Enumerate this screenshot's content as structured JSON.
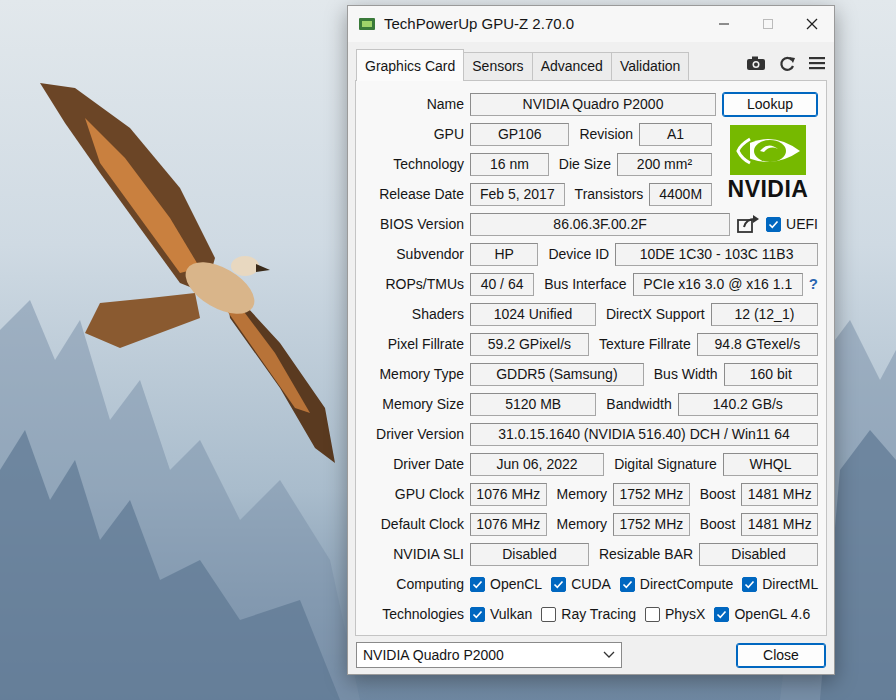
{
  "window": {
    "title": "TechPowerUp GPU-Z 2.70.0"
  },
  "tabs": [
    {
      "label": "Graphics Card",
      "selected": true
    },
    {
      "label": "Sensors",
      "selected": false
    },
    {
      "label": "Advanced",
      "selected": false
    },
    {
      "label": "Validation",
      "selected": false
    }
  ],
  "name_row": {
    "label": "Name",
    "value": "NVIDIA Quadro P2000",
    "button": "Lookup"
  },
  "logo": {
    "text": "NVIDIA"
  },
  "spec_rows": [
    {
      "label": "GPU",
      "cells": [
        {
          "value": "GP106"
        },
        {
          "label": "Revision",
          "value": "A1"
        }
      ]
    },
    {
      "label": "Technology",
      "cells": [
        {
          "value": "16 nm"
        },
        {
          "label": "Die Size",
          "value": "200 mm²"
        }
      ]
    },
    {
      "label": "Release Date",
      "cells": [
        {
          "value": "Feb 5, 2017"
        },
        {
          "label": "Transistors",
          "value": "4400M"
        }
      ]
    }
  ],
  "bios": {
    "label": "BIOS Version",
    "value": "86.06.3F.00.2F",
    "uefi": {
      "label": "UEFI",
      "checked": true
    }
  },
  "rows": [
    {
      "kind": "fields",
      "label": "Subvendor",
      "cells": [
        {
          "value": "HP"
        },
        {
          "label": "Device ID",
          "value": "10DE 1C30 - 103C 11B3"
        }
      ]
    },
    {
      "kind": "fields",
      "label": "ROPs/TMUs",
      "cells": [
        {
          "value": "40 / 64"
        },
        {
          "label": "Bus Interface",
          "value": "PCIe x16 3.0 @ x16 1.1"
        }
      ],
      "help": "?"
    },
    {
      "kind": "fields",
      "label": "Shaders",
      "cells": [
        {
          "value": "1024 Unified"
        },
        {
          "label": "DirectX Support",
          "value": "12 (12_1)"
        }
      ]
    },
    {
      "kind": "fields",
      "label": "Pixel Fillrate",
      "cells": [
        {
          "value": "59.2 GPixel/s"
        },
        {
          "label": "Texture Fillrate",
          "value": "94.8 GTexel/s"
        }
      ]
    },
    {
      "kind": "fields",
      "label": "Memory Type",
      "cells": [
        {
          "value": "GDDR5 (Samsung)"
        },
        {
          "label": "Bus Width",
          "value": "160 bit"
        }
      ]
    },
    {
      "kind": "fields",
      "label": "Memory Size",
      "cells": [
        {
          "value": "5120 MB"
        },
        {
          "label": "Bandwidth",
          "value": "140.2 GB/s"
        }
      ]
    },
    {
      "kind": "fields",
      "label": "Driver Version",
      "cells": [
        {
          "value": "31.0.15.1640 (NVIDIA 516.40) DCH / Win11 64"
        }
      ]
    },
    {
      "kind": "fields",
      "label": "Driver Date",
      "cells": [
        {
          "value": "Jun 06, 2022"
        },
        {
          "label": "Digital Signature",
          "value": "WHQL"
        }
      ]
    },
    {
      "kind": "fields",
      "label": "GPU Clock",
      "cells": [
        {
          "value": "1076 MHz"
        },
        {
          "label": "Memory",
          "value": "1752 MHz"
        },
        {
          "label": "Boost",
          "value": "1481 MHz"
        }
      ]
    },
    {
      "kind": "fields",
      "label": "Default Clock",
      "cells": [
        {
          "value": "1076 MHz"
        },
        {
          "label": "Memory",
          "value": "1752 MHz"
        },
        {
          "label": "Boost",
          "value": "1481 MHz"
        }
      ]
    },
    {
      "kind": "fields",
      "label": "NVIDIA SLI",
      "cells": [
        {
          "value": "Disabled"
        },
        {
          "label": "Resizable BAR",
          "value": "Disabled"
        }
      ]
    },
    {
      "kind": "checks",
      "label": "Computing",
      "items": [
        {
          "label": "OpenCL",
          "checked": true
        },
        {
          "label": "CUDA",
          "checked": true
        },
        {
          "label": "DirectCompute",
          "checked": true
        },
        {
          "label": "DirectML",
          "checked": true
        }
      ]
    },
    {
      "kind": "checks",
      "label": "Technologies",
      "items": [
        {
          "label": "Vulkan",
          "checked": true
        },
        {
          "label": "Ray Tracing",
          "checked": false
        },
        {
          "label": "PhysX",
          "checked": false
        },
        {
          "label": "OpenGL 4.6",
          "checked": true
        }
      ]
    }
  ],
  "footer": {
    "device": "NVIDIA Quadro P2000",
    "button": "Close"
  }
}
